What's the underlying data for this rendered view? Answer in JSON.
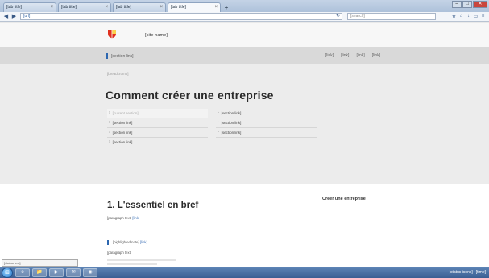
{
  "note": "placeholder",
  "browser": {
    "tabs": [
      {
        "label": "[tab title]",
        "active": false
      },
      {
        "label": "[tab title]",
        "active": false
      },
      {
        "label": "[tab title]",
        "active": false
      },
      {
        "label": "[tab title]",
        "active": true
      }
    ],
    "new_tab": "+",
    "url": "[url]",
    "search_placeholder": "[search]",
    "window_controls": [
      "–",
      "□",
      "✕"
    ],
    "toolbar_icons": [
      "star-icon",
      "home-icon",
      "download-icon",
      "bookmark-icon",
      "menu-icon"
    ]
  },
  "site": {
    "name": "[site name]",
    "brand_link": "[section link]",
    "nav_links": [
      "[link]",
      "[link]",
      "[link]",
      "[link]"
    ],
    "logo_color": "#e0301e"
  },
  "intro": {
    "breadcrumb": "[breadcrumb]",
    "title": "Comment créer une entreprise",
    "toc_left": [
      {
        "label": "[current section]",
        "current": true
      },
      {
        "label": "[section link]",
        "current": false
      },
      {
        "label": "[section link]",
        "current": false
      },
      {
        "label": "[section link]",
        "current": false
      }
    ],
    "toc_right": [
      {
        "label": "[section link]",
        "current": false
      },
      {
        "label": "[section link]",
        "current": false
      },
      {
        "label": "[section link]",
        "current": false
      }
    ]
  },
  "main": {
    "section_title": "1. L'essentiel en bref",
    "sidebar_title": "Créer une entreprise",
    "paragraph1": "[paragraph text]",
    "paragraph1_link": "[link]",
    "paragraph2": "[highlighted note]",
    "paragraph2_link": "[link]",
    "paragraph3": "[paragraph text]"
  },
  "status_tip": "[status text]",
  "taskbar": {
    "start": "⊞",
    "apps": [
      "e",
      "📁",
      "▶",
      "✉",
      "◉"
    ],
    "tray_items": [
      "[status icons]",
      "[time]"
    ]
  },
  "colors": {
    "accent": "#2d67b0",
    "link": "#3a6fb5",
    "page_bg": "#ebebeb",
    "topnav_bg": "#d9d9d9"
  }
}
